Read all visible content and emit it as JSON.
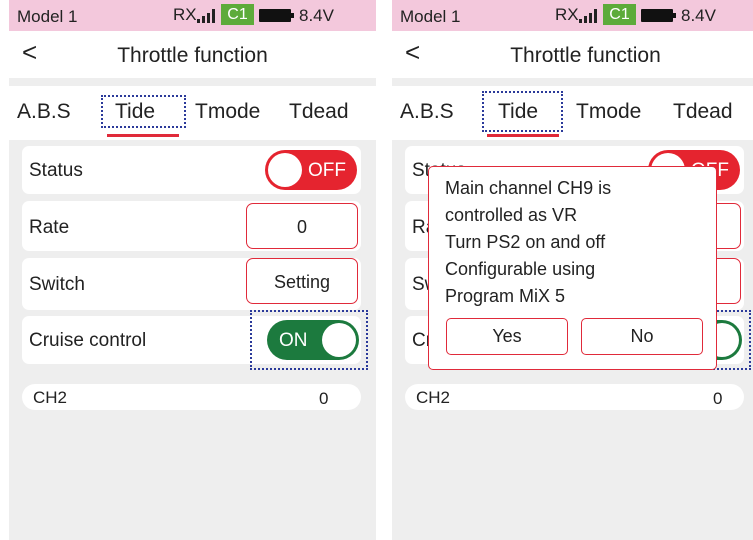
{
  "status_bar": {
    "model": "Model 1",
    "rx": "RX",
    "channel": "C1",
    "voltage": "8.4V"
  },
  "header": {
    "back": "<",
    "title": "Throttle function"
  },
  "tabs": [
    {
      "label": "A.B.S"
    },
    {
      "label": "Tide"
    },
    {
      "label": "Tmode"
    },
    {
      "label": "Tdead"
    }
  ],
  "selected_tab": "Tide",
  "settings": {
    "status": {
      "label": "Status",
      "value": "OFF"
    },
    "rate": {
      "label": "Rate",
      "value": "0"
    },
    "switch": {
      "label": "Switch",
      "value": "Setting"
    },
    "cruise": {
      "label": "Cruise control",
      "value": "ON"
    }
  },
  "channel_row": {
    "label": "CH2",
    "value": "0"
  },
  "dialog": {
    "lines": [
      "Main channel CH9 is",
      "controlled as VR",
      "Turn PS2 on and off",
      "Configurable using",
      "Program MiX 5"
    ],
    "yes": "Yes",
    "no": "No"
  },
  "colors": {
    "accent_red": "#e02a3a",
    "status_bar": "#f3c8dc",
    "channel_badge": "#5dab3a",
    "toggle_on": "#1c7a3e",
    "highlight": "#2b3a9a"
  }
}
